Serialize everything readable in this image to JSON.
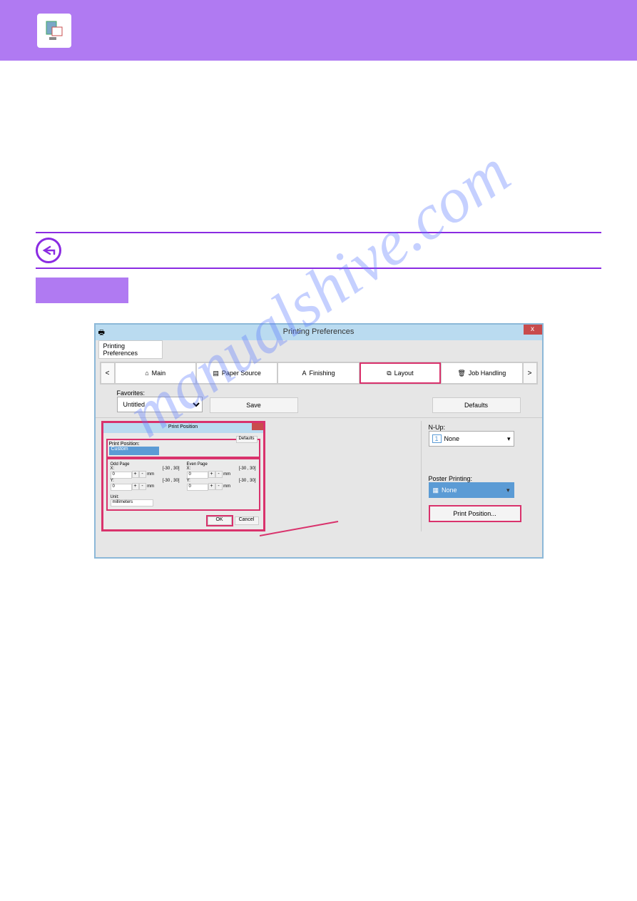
{
  "topbar": {
    "icon": "printer-doc-icon"
  },
  "dialog": {
    "title": "Printing Preferences",
    "tab_label": "Printing Preferences",
    "close": "x",
    "nav_prev": "<",
    "nav_next": ">",
    "tabs": [
      "Main",
      "Paper Source",
      "Finishing",
      "Layout",
      "Job Handling"
    ],
    "selected_tab_index": 3,
    "favorites_label": "Favorites:",
    "favorites_value": "Untitled",
    "save_label": "Save",
    "defaults_label": "Defaults"
  },
  "right_panel": {
    "nup_label": "N-Up:",
    "nup_value": "None",
    "nup_badge": "1",
    "poster_label": "Poster Printing:",
    "poster_value": "None",
    "print_position_btn": "Print Position..."
  },
  "pp_dialog": {
    "title": "Print Position",
    "defaults": "Defaults",
    "position_label": "Print Position:",
    "position_value": "Custom",
    "odd_label": "Odd Page",
    "even_label": "Even Page",
    "x_label": "X:",
    "y_label": "Y:",
    "range": "[-30 , 30]",
    "val": "0",
    "unit_mm": "mm",
    "unit_label": "Unit:",
    "unit_value": "millimeters",
    "ok": "OK",
    "cancel": "Cancel"
  },
  "watermark": "manualshive.com"
}
